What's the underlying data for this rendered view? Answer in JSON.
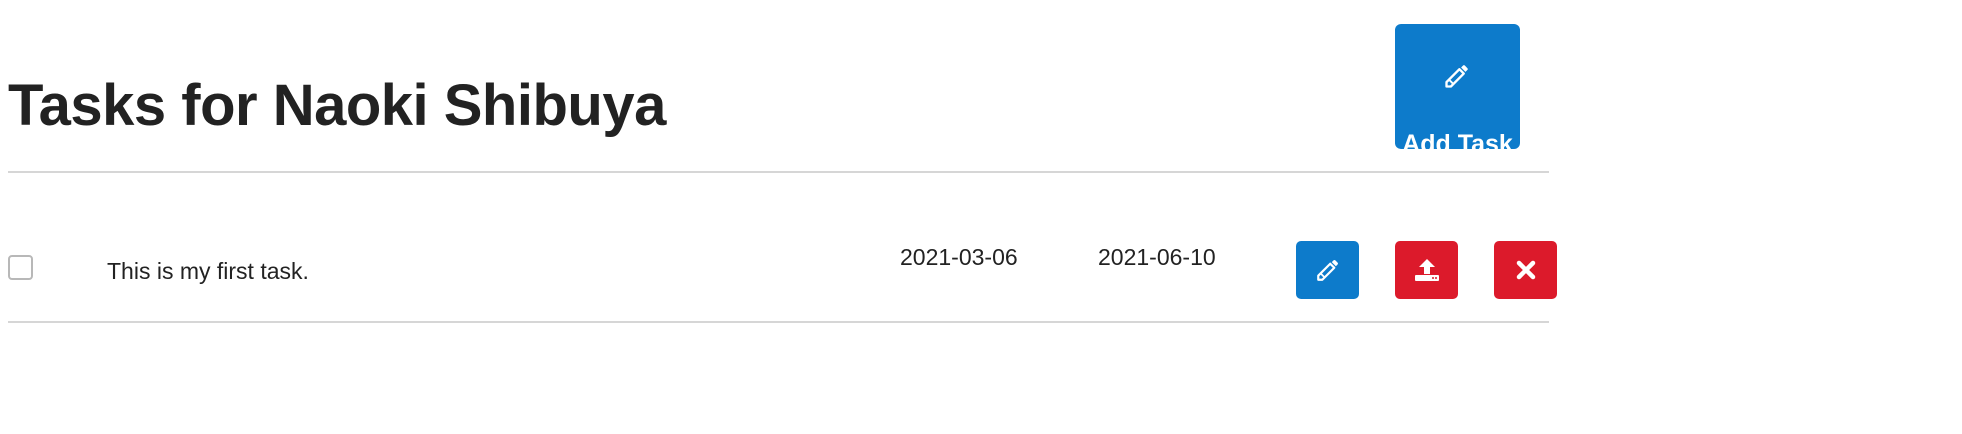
{
  "header": {
    "title": "Tasks for Naoki Shibuya",
    "add_task_label": "Add Task",
    "add_task_icon": "pencil-icon"
  },
  "tasks": [
    {
      "completed": false,
      "text": "This is my first task.",
      "start_date": "2021-03-06",
      "due_date": "2021-06-10",
      "actions": [
        {
          "name": "edit",
          "icon": "pencil-icon",
          "color": "#0d7bcb"
        },
        {
          "name": "upload",
          "icon": "upload-icon",
          "color": "#dc1a2b"
        },
        {
          "name": "delete",
          "icon": "close-icon",
          "color": "#dc1a2b"
        }
      ]
    }
  ],
  "colors": {
    "primary": "#0d7bcb",
    "danger": "#dc1a2b",
    "divider": "#d6d6d6",
    "text": "#222222"
  }
}
